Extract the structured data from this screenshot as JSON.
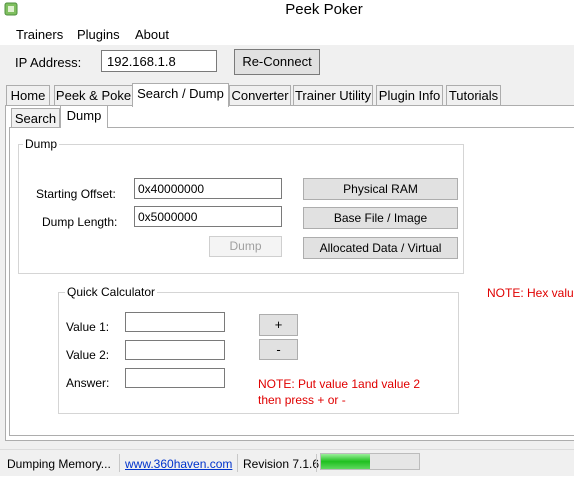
{
  "window": {
    "title": "Peek Poker"
  },
  "menu": {
    "items": [
      "Trainers",
      "Plugins",
      "About"
    ]
  },
  "connection": {
    "ip_label": "IP Address:",
    "ip_value": "192.168.1.8",
    "reconnect_label": "Re-Connect"
  },
  "tabs": [
    "Home",
    "Peek & Poke",
    "Search / Dump",
    "Converter",
    "Trainer Utility",
    "Plugin Info",
    "Tutorials"
  ],
  "active_tab": "Search / Dump",
  "subtabs": [
    "Search",
    "Dump"
  ],
  "active_subtab": "Dump",
  "dump": {
    "title": "Dump",
    "starting_offset_label": "Starting Offset:",
    "starting_offset_value": "0x40000000",
    "dump_length_label": "Dump Length:",
    "dump_length_value": "0x5000000",
    "dump_button": "Dump",
    "physical_ram_button": "Physical RAM",
    "base_file_button": "Base File / Image",
    "allocated_button": "Allocated Data / Virtual"
  },
  "hex_note": "NOTE: Hex valu",
  "calculator": {
    "title": "Quick Calculator",
    "value1_label": "Value 1:",
    "value2_label": "Value 2:",
    "answer_label": "Answer:",
    "value1": "",
    "value2": "",
    "answer": "",
    "plus_label": "+",
    "minus_label": "-",
    "note_line1": "NOTE: Put value 1and value 2",
    "note_line2": "then press + or -"
  },
  "status": {
    "message": "Dumping Memory...",
    "link": "www.360haven.com",
    "revision": "Revision 7.1.6",
    "progress": 0.5
  },
  "colors": {
    "note": "#e00000",
    "link": "#0033cc",
    "progress": "#1fc01f"
  }
}
